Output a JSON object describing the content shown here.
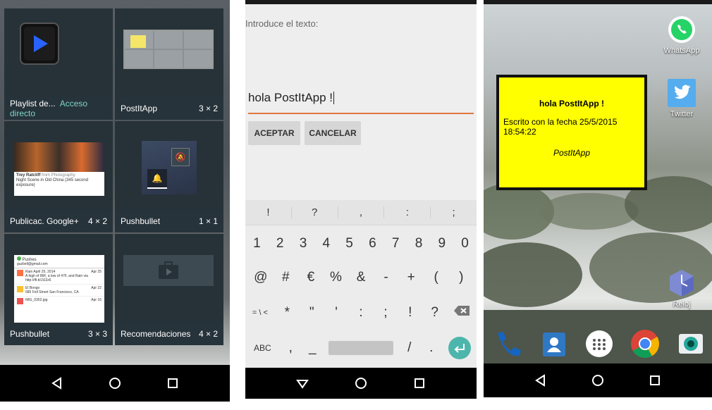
{
  "widgets": [
    {
      "name": "Playlist de...",
      "extra": "Acceso directo",
      "size": ""
    },
    {
      "name": "PostItApp",
      "extra": "",
      "size": "3 × 2"
    },
    {
      "name": "Publicac. Google+",
      "extra": "",
      "size": "4 × 2"
    },
    {
      "name": "Pushbullet",
      "extra": "",
      "size": "1 × 1"
    },
    {
      "name": "Pushbullet",
      "extra": "",
      "size": "3 × 3"
    },
    {
      "name": "Recomendaciones",
      "extra": "",
      "size": "4 × 2"
    }
  ],
  "gplus_preview": {
    "author": "Trey Ratcliff",
    "author_suffix": "from Photography",
    "caption": "Night Scene in Old China (345 second exposure)"
  },
  "pushes_preview": {
    "title": "Pushes",
    "account": "guzbell@gmail.com",
    "items": [
      {
        "title": "Rain April 25, 2014",
        "text": "A high of 86F, a low of 47F, and Rain via http://ift.tt/JIJ2z6",
        "date": "Apr 25"
      },
      {
        "title": "El Bongo",
        "text": "585 Fell Street San Francisco, CA",
        "date": "Apr 22"
      },
      {
        "title": "IMG_0302.jpg",
        "text": "",
        "date": "Apr 16"
      }
    ]
  },
  "editor": {
    "prompt": "Introduce el texto:",
    "value": "hola PostItApp !",
    "accept": "ACEPTAR",
    "cancel": "CANCELAR"
  },
  "keyboard": {
    "symbols": [
      "!",
      "?",
      ",",
      ":",
      ";"
    ],
    "row1": [
      "1",
      "2",
      "3",
      "4",
      "5",
      "6",
      "7",
      "8",
      "9",
      "0"
    ],
    "row2": [
      "@",
      "#",
      "€",
      "%",
      "&",
      "-",
      "+",
      "(",
      ")"
    ],
    "row3": [
      "= \\ <",
      "*",
      "\"",
      "'",
      ":",
      ";",
      "!",
      "?"
    ],
    "abc": "ABC",
    "comma": ",",
    "underscore": "_",
    "slash": "/",
    "dot": "."
  },
  "postit": {
    "title": "hola PostItApp !",
    "line1": "Escrito con la fecha 25/5/2015",
    "line2": "18:54:22",
    "signature": "PostItApp"
  },
  "home_apps": [
    {
      "label": "WhatsApp",
      "icon": "whatsapp-icon"
    },
    {
      "label": "Twitter",
      "icon": "twitter-icon"
    },
    {
      "label": "Reloj",
      "icon": "clock-icon"
    }
  ],
  "dock": [
    "phone-icon",
    "contacts-icon",
    "app-drawer-icon",
    "chrome-icon",
    "camera-icon"
  ],
  "colors": {
    "postit_bg": "#ffff00",
    "accent": "#4db6ac",
    "whatsapp": "#25d366",
    "twitter": "#55acee"
  }
}
